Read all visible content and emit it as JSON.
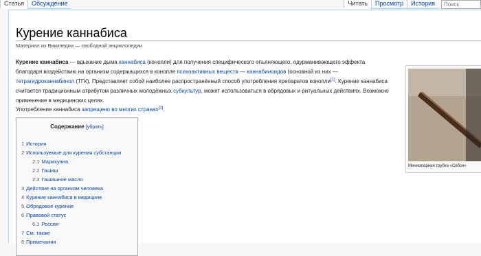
{
  "tabs_left": [
    "Статья",
    "Обсуждение"
  ],
  "tabs_right": [
    "Читать",
    "Просмотр",
    "История"
  ],
  "search": {
    "placeholder": "Поиск"
  },
  "page": {
    "title": "Курение каннабиса",
    "tagline": "Материал из Википедии — свободной энциклопедии"
  },
  "intro": {
    "bold": "Курение каннабиса",
    "t1": " — вдыхание дыма ",
    "l1": "каннабиса",
    "t2": " (конопли) для получения специфического опьяняющего, одурманивающего эффекта благодаря воздействию на организм содержащихся в конопле ",
    "l2": "психоактивных веществ",
    "t3": " — ",
    "l3": "каннабиноидов",
    "t4": " (основной из них — ",
    "l4": "тетрагидроканнабинол",
    "t5": " (ТГК). Представляет собой наиболее распространённый способ употребления препаратов конопли",
    "ref1": "[1]",
    "t6": ". Курение каннабиса считается традиционным атрибутом различных молодёжных ",
    "l5": "субкультур",
    "t7": ", может использоваться в обрядовых и ритуальных действиях. Возможно применение в медицинских целях."
  },
  "para2": {
    "t1": "Употребление каннабиса ",
    "l1": "запрещено во многих странах",
    "ref2": "[2]",
    "t2": "."
  },
  "toc": {
    "title": "Содержание",
    "hide": "[убрать]",
    "items": [
      {
        "num": "1",
        "label": "История"
      },
      {
        "num": "2",
        "label": "Используемые для курения субстанции"
      },
      {
        "num": "2.1",
        "label": "Марихуана"
      },
      {
        "num": "2.2",
        "label": "Гашиш"
      },
      {
        "num": "2.3",
        "label": "Гашишное масло"
      },
      {
        "num": "3",
        "label": "Действие на организм человека"
      },
      {
        "num": "4",
        "label": "Курение каннабиса в медицине"
      },
      {
        "num": "5",
        "label": "Обрядовое курение"
      },
      {
        "num": "6",
        "label": "Правовой статус"
      },
      {
        "num": "6.1",
        "label": "Россия"
      },
      {
        "num": "7",
        "label": "См. также"
      },
      {
        "num": "8",
        "label": "Примечания"
      }
    ]
  },
  "thumb": {
    "caption": "Миниатюрная трубка «Себси»"
  }
}
